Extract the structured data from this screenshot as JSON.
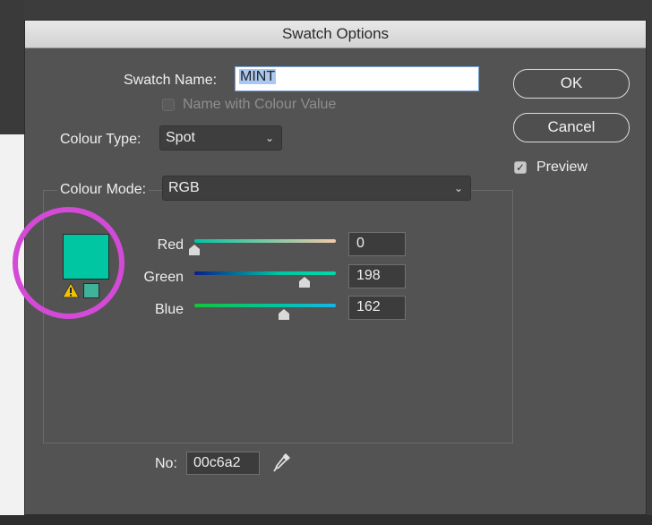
{
  "dialog": {
    "title": "Swatch Options"
  },
  "swatch_name": {
    "label": "Swatch Name:",
    "value": "MINT"
  },
  "name_with_colour_value": {
    "label": "Name with Colour Value",
    "checked": false,
    "enabled": false
  },
  "colour_type": {
    "label": "Colour Type:",
    "value": "Spot"
  },
  "colour_mode": {
    "label": "Colour Mode:",
    "value": "RGB"
  },
  "buttons": {
    "ok": "OK",
    "cancel": "Cancel"
  },
  "preview": {
    "label": "Preview",
    "checked": true
  },
  "colour": {
    "hex": "#00c6a2",
    "out_of_gamut_hex": "#3fb39a",
    "channels": [
      {
        "label": "Red",
        "value": "0",
        "fraction": 0.0
      },
      {
        "label": "Green",
        "value": "198",
        "fraction": 0.776
      },
      {
        "label": "Blue",
        "value": "162",
        "fraction": 0.635
      }
    ]
  },
  "hex_field": {
    "label": "No:",
    "value": "00c6a2"
  },
  "icons": {
    "warning": "gamut-warning-icon",
    "eyedropper": "eyedropper-icon",
    "chevron": "chevron-down-icon"
  },
  "annotation": {
    "color": "#d24ad6"
  }
}
